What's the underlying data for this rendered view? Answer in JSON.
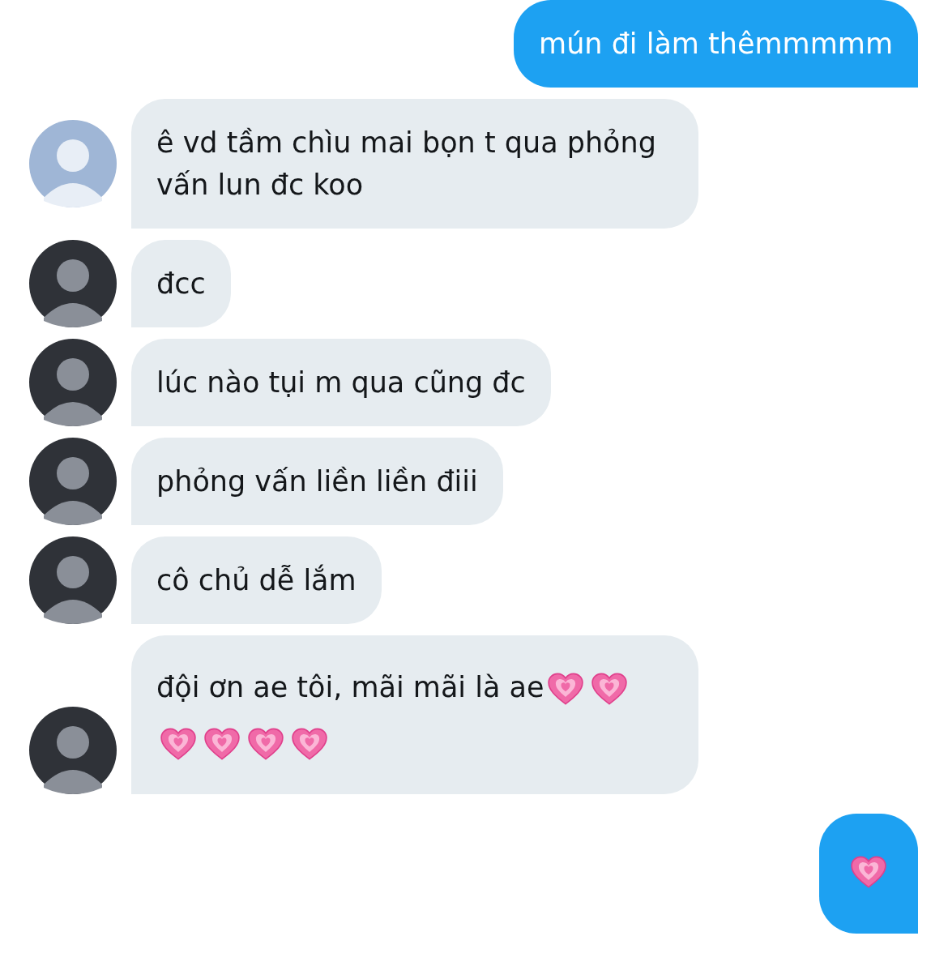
{
  "messages": [
    {
      "kind": "outgoing",
      "parts": [
        {
          "kind": "text",
          "text": "mún đi làm thêmmmmm"
        }
      ]
    },
    {
      "kind": "incoming",
      "avatar": {
        "kind": "light"
      },
      "parts": [
        {
          "kind": "text",
          "text": "ê vd tầm chìu mai bọn t qua phỏng vấn lun đc koo"
        }
      ]
    },
    {
      "kind": "incoming",
      "avatar": {
        "kind": "dark"
      },
      "parts": [
        {
          "kind": "text",
          "text": "đcc"
        }
      ]
    },
    {
      "kind": "incoming",
      "avatar": {
        "kind": "dark"
      },
      "parts": [
        {
          "kind": "text",
          "text": "lúc nào tụi m qua cũng đc"
        }
      ]
    },
    {
      "kind": "incoming",
      "avatar": {
        "kind": "dark"
      },
      "parts": [
        {
          "kind": "text",
          "text": "phỏng vấn liền liền điii"
        }
      ]
    },
    {
      "kind": "incoming",
      "avatar": {
        "kind": "dark"
      },
      "parts": [
        {
          "kind": "text",
          "text": "cô chủ dễ lắm"
        }
      ]
    },
    {
      "kind": "incoming",
      "avatar": {
        "kind": "dark"
      },
      "parts": [
        {
          "kind": "text",
          "text": "đội ơn ae tôi, mãi mãi là ae"
        },
        {
          "kind": "heart"
        },
        {
          "kind": "heart"
        },
        {
          "kind": "heart"
        },
        {
          "kind": "heart"
        },
        {
          "kind": "heart"
        },
        {
          "kind": "heart"
        }
      ]
    },
    {
      "kind": "outgoing",
      "parts": [
        {
          "kind": "heart"
        }
      ]
    }
  ]
}
